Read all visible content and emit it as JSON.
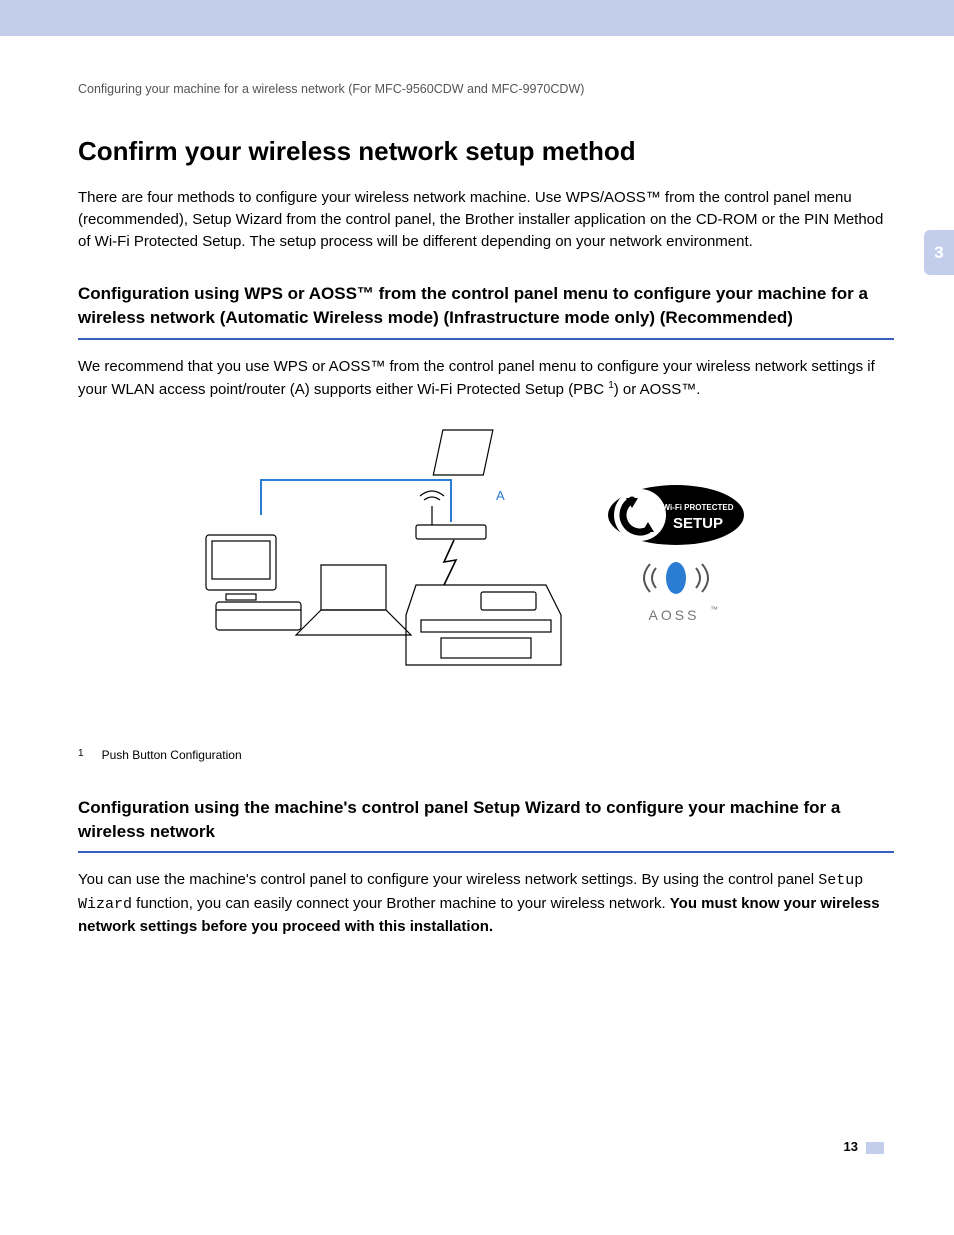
{
  "breadcrumb": "Configuring your machine for a wireless network (For MFC-9560CDW and MFC-9970CDW)",
  "chapter_number": "3",
  "title": "Confirm your wireless network setup method",
  "intro": "There are four methods to configure your wireless network machine. Use WPS/AOSS™ from the control panel menu (recommended), Setup Wizard from the control panel, the Brother installer application on the CD-ROM or the PIN Method of Wi-Fi Protected Setup. The setup process will be different depending on your network environment.",
  "section1": {
    "heading": "Configuration using WPS or AOSS™ from the control panel menu to configure your machine for a wireless network (Automatic Wireless mode) (Infrastructure mode only) (Recommended)",
    "body_pre": "We recommend that you use WPS or AOSS™ from the control panel menu to configure your wireless network settings if your WLAN access point/router (A) supports either Wi-Fi Protected Setup (PBC ",
    "body_post": ") or AOSS™.",
    "footnote_num": "1",
    "footnote_text": "Push Button Configuration",
    "diagram_label": "A",
    "wps_label_top": "Wi-Fi PROTECTED",
    "wps_label_bottom": "SETUP",
    "aoss_label": "AOSS",
    "aoss_tm": "™"
  },
  "section2": {
    "heading": "Configuration using the machine's control panel Setup Wizard to configure your machine for a wireless network",
    "body_pre": "You can use the machine's control panel to configure your wireless network settings. By using the control panel ",
    "body_mono": "Setup Wizard",
    "body_mid": " function, you can easily connect your Brother machine to your wireless network. ",
    "body_bold": "You must know your wireless network settings before you proceed with this installation."
  },
  "page_number": "13"
}
